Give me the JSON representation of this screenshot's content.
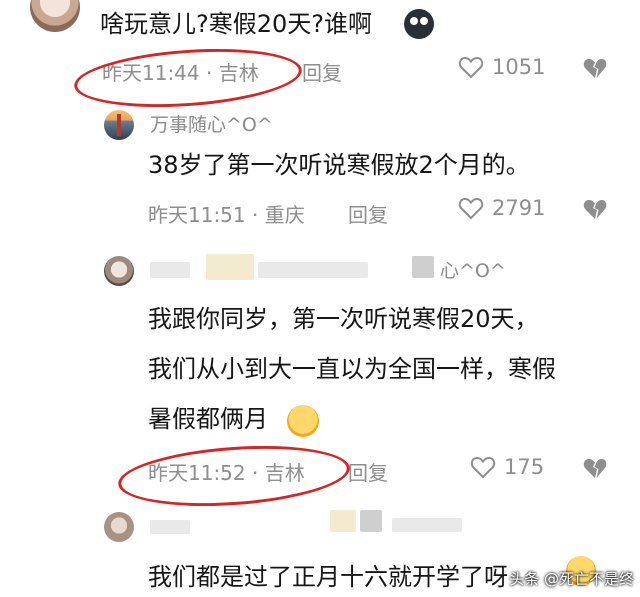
{
  "comment_main": {
    "text": "啥玩意儿?寒假20天?谁啊",
    "time_location": "昨天11:44 · 吉林",
    "reply_label": "回复",
    "like_count": "1051"
  },
  "reply_1": {
    "username": "万事随心^O^",
    "text": "38岁了第一次听说寒假放2个月的。",
    "time_location": "昨天11:51 · 重庆",
    "reply_label": "回复",
    "like_count": "2791"
  },
  "reply_2": {
    "username_visible": "心^O^",
    "text_line1": "我跟你同岁，第一次听说寒假20天，",
    "text_line2": "我们从小到大一直以为全国一样，寒假",
    "text_line3": "暑假都俩月",
    "time_location": "昨天11:52 · 吉林",
    "reply_label": "回复",
    "like_count": "175"
  },
  "reply_3": {
    "text": "我们都是过了正月十六就开学了呀"
  },
  "watermark": "头条 @死亡不是终",
  "colors": {
    "annotation_red": "#d82424",
    "meta_gray": "#8e8e8e"
  },
  "icons": [
    "heart-outline-icon",
    "broken-heart-icon",
    "dark-emoji-icon",
    "face-emoji-icon"
  ]
}
